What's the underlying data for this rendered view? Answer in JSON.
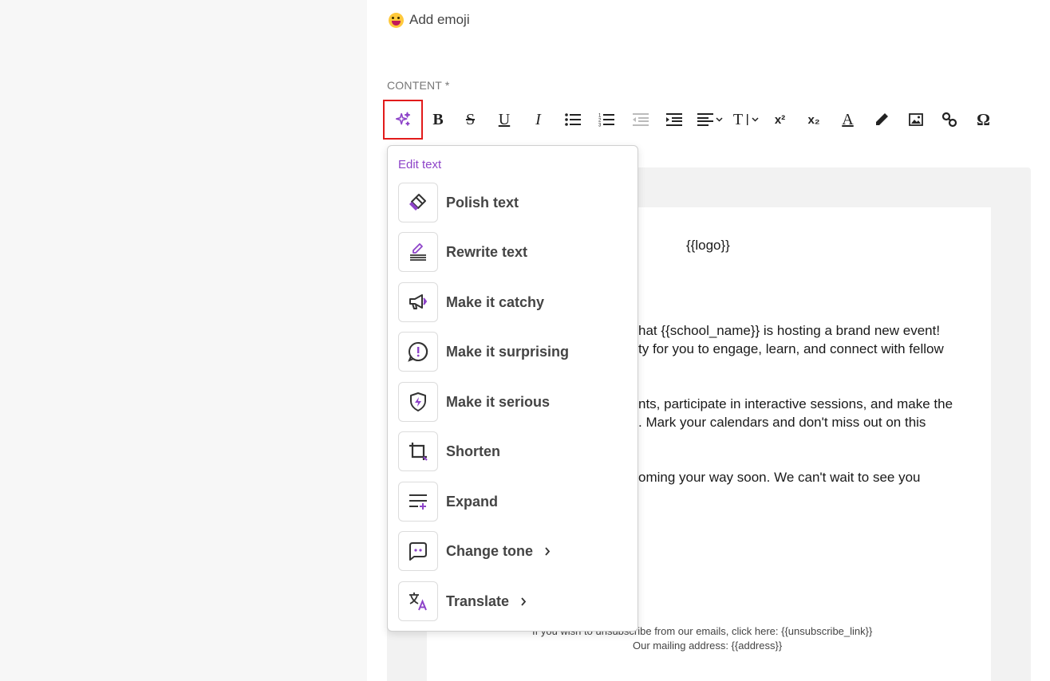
{
  "emoji": {
    "label": "Add emoji",
    "icon": "emoji-face-icon"
  },
  "content": {
    "label": "CONTENT *"
  },
  "toolbar": {
    "buttons": [
      {
        "icon": "ai-sparkle-icon"
      },
      {
        "icon": "bold-icon",
        "text": "B"
      },
      {
        "icon": "strikethrough-icon",
        "text": "S"
      },
      {
        "icon": "underline-icon",
        "text": "U"
      },
      {
        "icon": "italic-icon",
        "text": "I"
      },
      {
        "icon": "bullet-list-icon"
      },
      {
        "icon": "numbered-list-icon"
      },
      {
        "icon": "outdent-icon"
      },
      {
        "icon": "indent-icon"
      },
      {
        "icon": "align-dropdown-icon"
      },
      {
        "icon": "font-size-dropdown-icon",
        "text": "T"
      },
      {
        "icon": "superscript-icon",
        "text": "x²"
      },
      {
        "icon": "subscript-icon",
        "text": "x₂"
      },
      {
        "icon": "text-color-icon",
        "text": "A"
      },
      {
        "icon": "pen-icon"
      },
      {
        "icon": "image-icon"
      },
      {
        "icon": "link-icon"
      },
      {
        "icon": "special-char-icon",
        "text": "Ω"
      }
    ]
  },
  "menu": {
    "header": "Edit text",
    "items": [
      {
        "label": "Polish text",
        "icon": "polish-eraser-icon",
        "submenu": false
      },
      {
        "label": "Rewrite text",
        "icon": "rewrite-pen-icon",
        "submenu": false
      },
      {
        "label": "Make it catchy",
        "icon": "megaphone-icon",
        "submenu": false
      },
      {
        "label": "Make it surprising",
        "icon": "exclamation-bubble-icon",
        "submenu": false
      },
      {
        "label": "Make it serious",
        "icon": "shield-bolt-icon",
        "submenu": false
      },
      {
        "label": "Shorten",
        "icon": "crop-icon",
        "submenu": false
      },
      {
        "label": "Expand",
        "icon": "expand-lines-icon",
        "submenu": false
      },
      {
        "label": "Change tone",
        "icon": "tone-bubble-icon",
        "submenu": true
      },
      {
        "label": "Translate",
        "icon": "translate-icon",
        "submenu": true
      }
    ]
  },
  "email": {
    "logo": "{{logo}}",
    "p1_line1": "hat {{school_name}} is hosting a brand new event!",
    "p1_line2": "ty for you to engage, learn, and connect with fellow",
    "p2_line1": "nts, participate in interactive sessions, and make the",
    "p2_line2": ". Mark your calendars and don't miss out on this",
    "p3_line1": "oming your way soon. We can't wait to see you",
    "footer_unsubscribe": "If you wish to unsubscribe from our emails, click here: {{unsubscribe_link}}",
    "footer_address": "Our mailing address: {{address}}"
  },
  "colors": {
    "accent": "#8e44c9",
    "highlight_border": "#e21b1b"
  }
}
